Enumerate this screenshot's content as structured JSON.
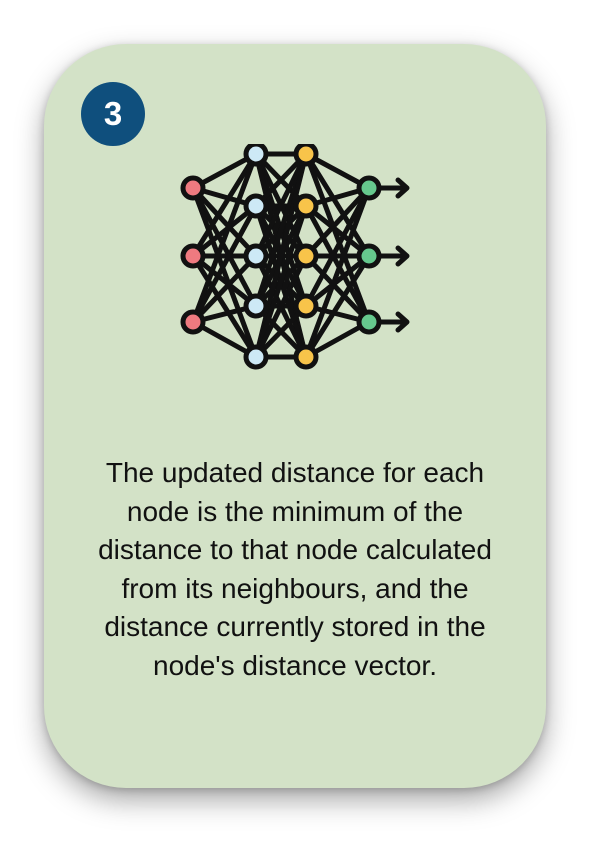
{
  "step": {
    "number": "3"
  },
  "illustration": {
    "icon": "neural-network-icon",
    "colors": {
      "input_nodes": "#ef7a80",
      "hidden_nodes_1": "#cde9f6",
      "hidden_nodes_2": "#f8c44a",
      "output_nodes": "#66c98e",
      "lines": "#111111"
    }
  },
  "description": {
    "text": "The updated distance for each node is the minimum of the distance to that node calculated from its neighbours, and the distance currently stored in the node's distance vector."
  },
  "colors": {
    "card_background": "#d3e2c7",
    "badge_background": "#0f4f7d"
  }
}
